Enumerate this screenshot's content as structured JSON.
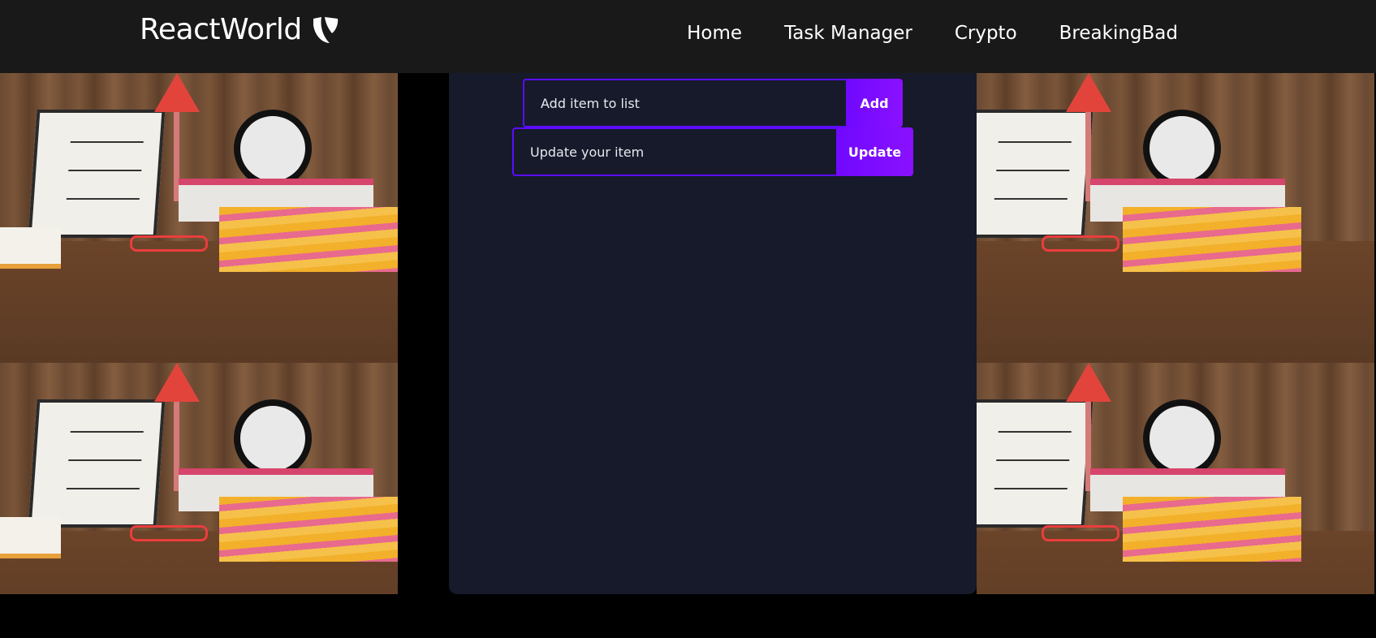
{
  "navbar": {
    "brand": "ReactWorld",
    "brand_icon": "typo3-icon",
    "links": [
      "Home",
      "Task Manager",
      "Crypto",
      "BreakingBad"
    ]
  },
  "todo": {
    "add_placeholder": "Add item to list",
    "add_button": "Add",
    "update_placeholder": "Update your item",
    "update_button": "Update"
  },
  "colors": {
    "navbar_bg": "#1a1919",
    "panel_bg": "#161a2b",
    "accent": "#5d0cff",
    "button": "#7008ff"
  }
}
